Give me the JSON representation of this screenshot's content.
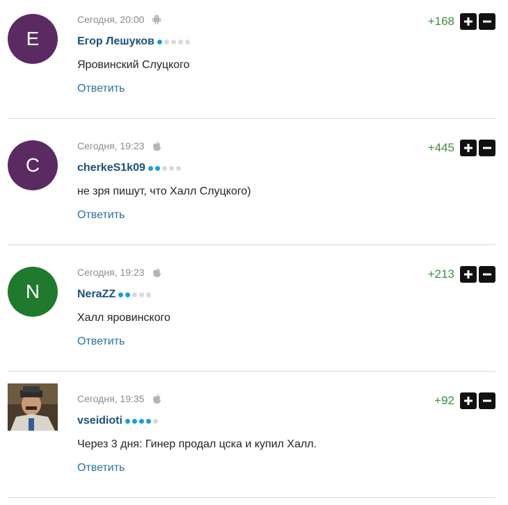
{
  "comments": [
    {
      "avatar_letter": "E",
      "avatar_color": "#5b2a63",
      "time": "Сегодня, 20:00",
      "device": "android-icon",
      "author": "Егор Лешуков",
      "rank_level": 1,
      "text": "Яровинский Слуцкого",
      "reply": "Ответить",
      "score": "+168"
    },
    {
      "avatar_letter": "C",
      "avatar_color": "#5b2a63",
      "time": "Сегодня, 19:23",
      "device": "apple-icon",
      "author": "cherkeS1k09",
      "rank_level": 2,
      "text": "не зря пишут, что Халл Слуцкого)",
      "reply": "Ответить",
      "score": "+445"
    },
    {
      "avatar_letter": "N",
      "avatar_color": "#1f7a2e",
      "time": "Сегодня, 19:23",
      "device": "apple-icon",
      "author": "NeraZZ",
      "rank_level": 2,
      "text": "Халл яровинского",
      "reply": "Ответить",
      "score": "+213"
    },
    {
      "avatar_letter": "",
      "avatar_color": "#6b4a2c",
      "time": "Сегодня, 19:35",
      "device": "apple-icon",
      "author": "vseidioti",
      "rank_level": 4,
      "text": "Через 3 дня: Гинер продал цска и купил Халл.",
      "reply": "Ответить",
      "score": "+92"
    }
  ]
}
